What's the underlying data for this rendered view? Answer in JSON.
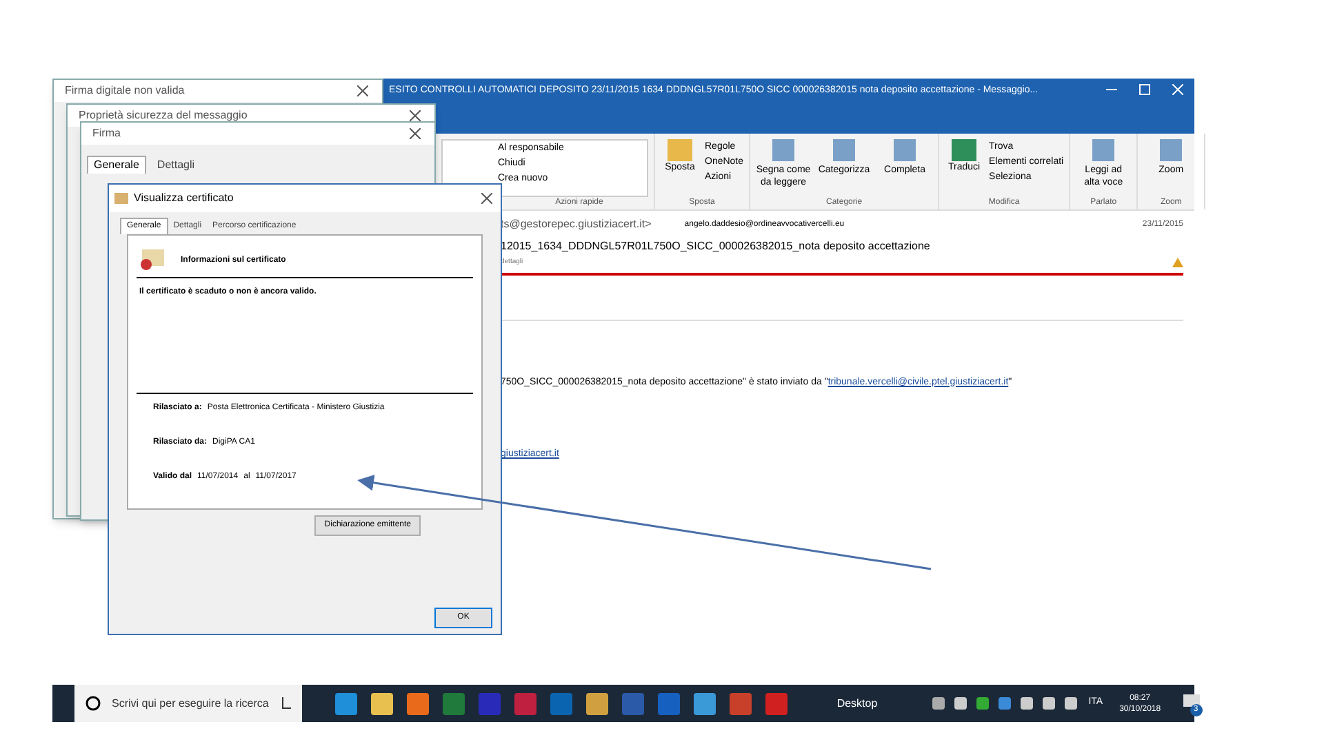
{
  "outlook": {
    "title": "ESITO CONTROLLI AUTOMATICI DEPOSITO 23/11/2015 1634 DDDNGL57R01L750O SICC 000026382015 nota deposito accettazione - Messaggio...",
    "ribbon_groups": [
      {
        "label": "Azioni rapide",
        "kind": "quicksteps",
        "items": [
          "Al responsabile",
          "Chiudi",
          "Crea nuovo"
        ]
      },
      {
        "label": "Sposta",
        "kind": "move",
        "big": "Sposta",
        "items": [
          "Regole",
          "OneNote",
          "Azioni"
        ]
      },
      {
        "label": "Categorie",
        "kind": "big",
        "buttons": [
          "Segna come da leggere",
          "Categorizza",
          "Completa"
        ]
      },
      {
        "label": "Modifica",
        "kind": "edit",
        "big": "Traduci",
        "items": [
          "Trova",
          "Elementi correlati",
          "Seleziona"
        ]
      },
      {
        "label": "Parlato",
        "kind": "big",
        "buttons": [
          "Leggi ad alta voce"
        ]
      },
      {
        "label": "Zoom",
        "kind": "big",
        "buttons": [
          "Zoom"
        ]
      }
    ],
    "sender": "ts@gestorepec.giustiziacert.it>",
    "recipient": "angelo.daddesio@ordineavvocativercelli.eu",
    "date": "23/11/2015",
    "subject": "12015_1634_DDDNGL57R01L750O_SICC_000026382015_nota deposito accettazione",
    "details": "dettagli",
    "body_text": "750O_SICC_000026382015_nota deposito accettazione\" è stato inviato da \"",
    "body_link": "tribunale.vercelli@civile.ptel.giustiziacert.it",
    "body_end": "\"",
    "body_link_2": "giustiziacert.it"
  },
  "dialogs": [
    {
      "title": "Firma digitale non valida"
    },
    {
      "title": "Proprietà sicurezza del messaggio"
    },
    {
      "title": "Firma",
      "tabs": [
        {
          "label": "Generale",
          "selected": true
        },
        {
          "label": "Dettagli",
          "selected": false
        }
      ]
    }
  ],
  "certificate": {
    "title": "Visualizza certificato",
    "tabs": [
      {
        "label": "Generale",
        "selected": true
      },
      {
        "label": "Dettagli",
        "selected": false
      },
      {
        "label": "Percorso certificazione",
        "selected": false
      }
    ],
    "heading": "Informazioni sul certificato",
    "warning": "Il certificato è scaduto o non è ancora valido.",
    "issued_to_label": "Rilasciato a:",
    "issued_to": "Posta Elettronica Certificata - Ministero Giustizia",
    "issued_by_label": "Rilasciato da:",
    "issued_by": "DigiPA CA1",
    "valid_from_label": "Valido dal",
    "valid_from": "11/07/2014",
    "valid_to_label": "al",
    "valid_to": "11/07/2017",
    "issuer_button": "Dichiarazione emittente",
    "ok_button": "OK"
  },
  "taskbar": {
    "search_placeholder": "Scrivi qui per eseguire la ricerca",
    "desktop": "Desktop",
    "language": "ITA",
    "time": "08:27",
    "date": "30/10/2018",
    "notifications": "3"
  }
}
